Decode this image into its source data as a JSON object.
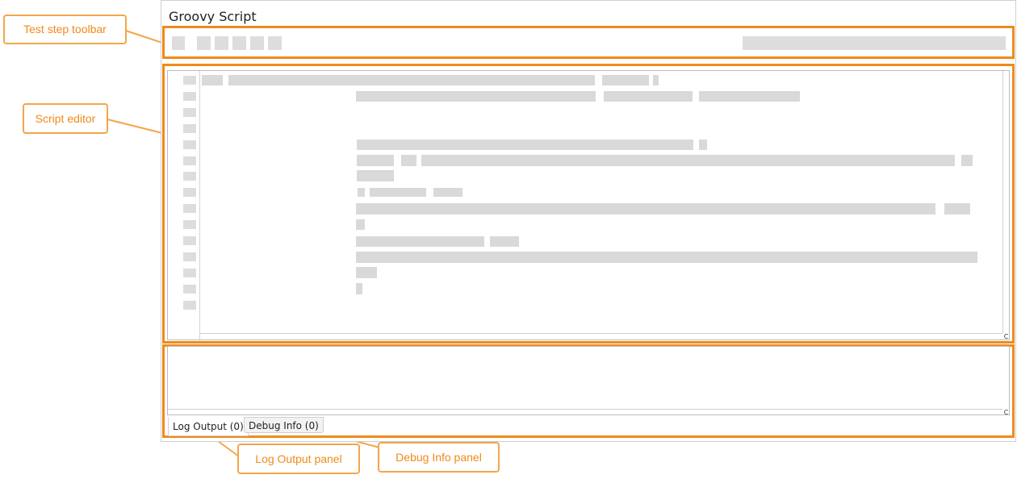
{
  "window": {
    "title": "Groovy Script"
  },
  "tabs": [
    {
      "label": "Log Output (0)",
      "active": true
    },
    {
      "label": "Debug Info (0)",
      "active": false
    }
  ],
  "callouts": {
    "toolbar": "Test step toolbar",
    "editor": "Script editor",
    "log_output": "Log Output panel",
    "debug_info": "Debug Info panel"
  },
  "scrollbar_corner_glyph": "C",
  "colors": {
    "highlight": "#f08a1a",
    "callout_border": "#f3a64a",
    "placeholder": "#dddddd"
  }
}
